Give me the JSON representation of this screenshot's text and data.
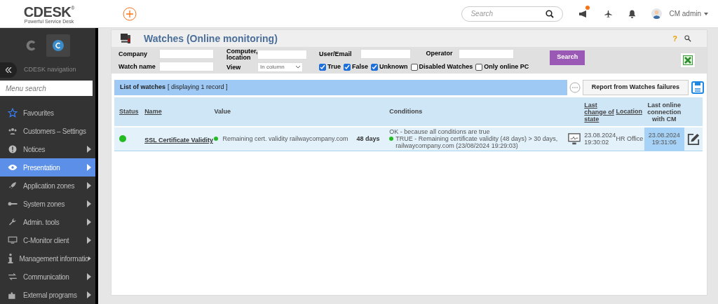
{
  "header": {
    "logo": "CDESK",
    "logo_mark": "®",
    "tagline": "Powerful Service Desk",
    "search": {
      "placeholder": "Search"
    },
    "user": "CM admin"
  },
  "sidebar": {
    "nav_title": "CDESK navigation",
    "menu_search": {
      "placeholder": "Menu search"
    },
    "items": [
      {
        "label": "Favourites",
        "kind": "star",
        "submenu": false,
        "selected": false
      },
      {
        "label": "Customers – Settings",
        "kind": "users",
        "submenu": false,
        "selected": false
      },
      {
        "label": "Notices",
        "kind": "alert",
        "submenu": true,
        "selected": false
      },
      {
        "label": "Presentation",
        "kind": "eye",
        "submenu": true,
        "selected": true
      },
      {
        "label": "Application zones",
        "kind": "rocket",
        "submenu": true,
        "selected": false
      },
      {
        "label": "System zones",
        "kind": "key",
        "submenu": true,
        "selected": false
      },
      {
        "label": "Admin. tools",
        "kind": "wrench",
        "submenu": true,
        "selected": false
      },
      {
        "label": "C-Monitor client",
        "kind": "monitor",
        "submenu": true,
        "selected": false
      },
      {
        "label": "Management informatio",
        "kind": "info",
        "submenu": true,
        "selected": false
      },
      {
        "label": "Communication",
        "kind": "arrows",
        "submenu": true,
        "selected": false
      },
      {
        "label": "External programs",
        "kind": "puzzle",
        "submenu": true,
        "selected": false
      }
    ]
  },
  "page": {
    "title": "Watches (Online monitoring)",
    "help": "?",
    "filters": {
      "company": "Company",
      "computer": "Computer, location",
      "user": "User/Email",
      "operator": "Operator",
      "watch_name": "Watch name",
      "view": "View",
      "view_value": "In column",
      "checks": [
        {
          "label": "True",
          "checked": true
        },
        {
          "label": "False",
          "checked": true
        },
        {
          "label": "Unknown",
          "checked": true
        },
        {
          "label": "Disabled Watches",
          "checked": false
        },
        {
          "label": "Only online PC",
          "checked": false
        }
      ],
      "search_button": "Search"
    },
    "list": {
      "title": "List of watches",
      "count": "[ displaying 1 record ]",
      "report_button": "Report from Watches failures"
    },
    "table": {
      "columns": [
        "Status",
        "Name",
        "Value",
        "Conditions",
        "Last change of state",
        "Location",
        "Last online connection with CM"
      ],
      "rows": [
        {
          "color": "#22bb22",
          "name": "SSL Certificate Validity",
          "value": "Remaining cert. validity railwaycompany.com",
          "value_amount": "48 days",
          "condition_summary": "OK - because all conditions are true",
          "condition_detail": "TRUE - Remaining certificate validity (48 days) > 30 days, railwaycompany.com (23/08/2024 19:29:03)",
          "last_change": "23.08.2024 19:30:02",
          "location": "HR Office",
          "last_online": "23.08.2024 19:31:06"
        }
      ]
    }
  }
}
